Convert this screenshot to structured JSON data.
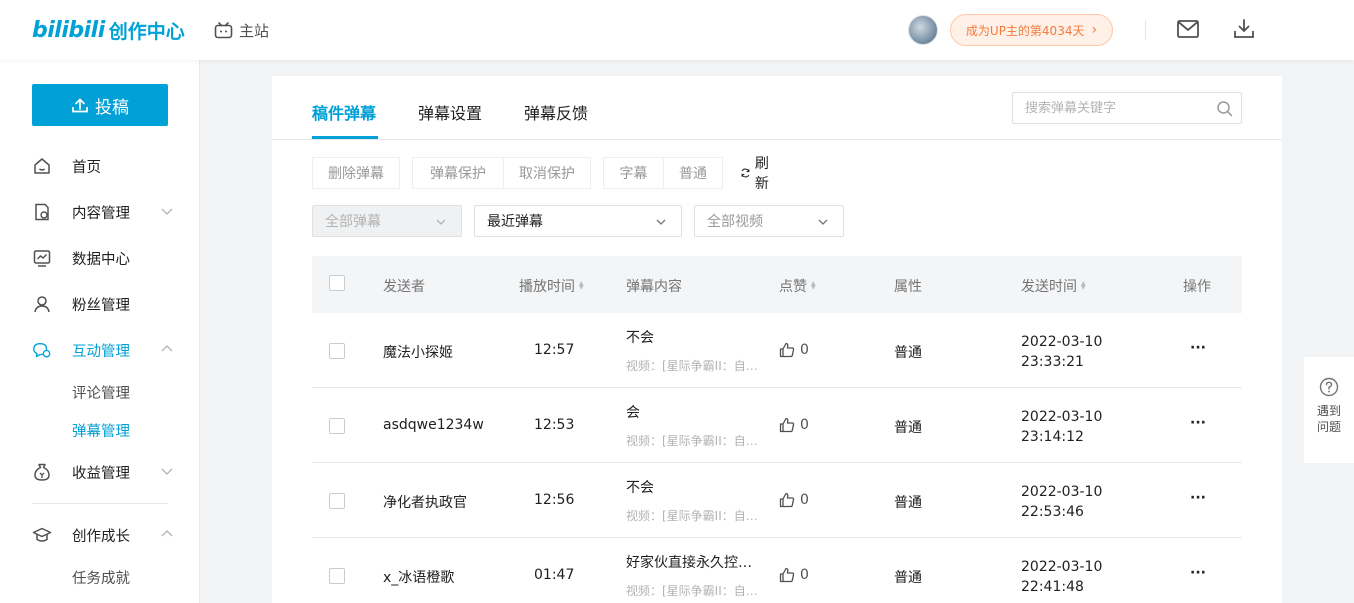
{
  "header": {
    "brand": "bilibili",
    "brand_sub": "创作中心",
    "home_link": "主站",
    "up_badge": "成为UP主的第4034天",
    "up_badge_arrow": "›"
  },
  "sidebar": {
    "upload_label": "投稿",
    "items": [
      {
        "label": "首页",
        "icon": "home-icon"
      },
      {
        "label": "内容管理",
        "icon": "content-icon"
      },
      {
        "label": "数据中心",
        "icon": "chart-icon"
      },
      {
        "label": "粉丝管理",
        "icon": "fans-icon"
      },
      {
        "label": "互动管理",
        "icon": "interact-icon"
      },
      {
        "label": "收益管理",
        "icon": "income-icon"
      },
      {
        "label": "创作成长",
        "icon": "growth-icon"
      }
    ],
    "sub_items": {
      "comment": "评论管理",
      "danmaku": "弹幕管理",
      "tasks": "任务成就"
    }
  },
  "tabs": [
    "稿件弹幕",
    "弹幕设置",
    "弹幕反馈"
  ],
  "search": {
    "placeholder": "搜索弹幕关键字"
  },
  "toolbar": {
    "delete": "删除弹幕",
    "protect": "弹幕保护",
    "unprotect": "取消保护",
    "subtitle": "字幕",
    "normal": "普通",
    "refresh": "刷新"
  },
  "filters": {
    "type": "全部弹幕",
    "time": "最近弹幕",
    "video": "全部视频"
  },
  "table": {
    "columns": {
      "sender": "发送者",
      "play_time": "播放时间",
      "content": "弹幕内容",
      "likes": "点赞",
      "attribute": "属性",
      "send_time": "发送时间",
      "ops": "操作"
    },
    "rows": [
      {
        "sender": "魔法小探姬",
        "time": "12:57",
        "content": "不会",
        "video": "视频：[星际争霸II：自…",
        "likes": "0",
        "attr": "普通",
        "date": "2022-03-10",
        "clock": "23:33:21"
      },
      {
        "sender": "asdqwe1234w",
        "time": "12:53",
        "content": "会",
        "video": "视频：[星际争霸II：自…",
        "likes": "0",
        "attr": "普通",
        "date": "2022-03-10",
        "clock": "23:14:12"
      },
      {
        "sender": "净化者执政官",
        "time": "12:56",
        "content": "不会",
        "video": "视频：[星际争霸II：自…",
        "likes": "0",
        "attr": "普通",
        "date": "2022-03-10",
        "clock": "22:53:46"
      },
      {
        "sender": "x_冰语橙歌",
        "time": "01:47",
        "content": "好家伙直接永久控…",
        "video": "视频：[星际争霸II：自…",
        "likes": "0",
        "attr": "普通",
        "date": "2022-03-10",
        "clock": "22:41:48"
      }
    ],
    "ops_glyph": "···"
  },
  "help": {
    "label": "遇到问题",
    "icon": "question-icon"
  },
  "colors": {
    "accent": "#00a1d6",
    "badge_text": "#f17b3d",
    "badge_bg": "#fff1e8"
  }
}
